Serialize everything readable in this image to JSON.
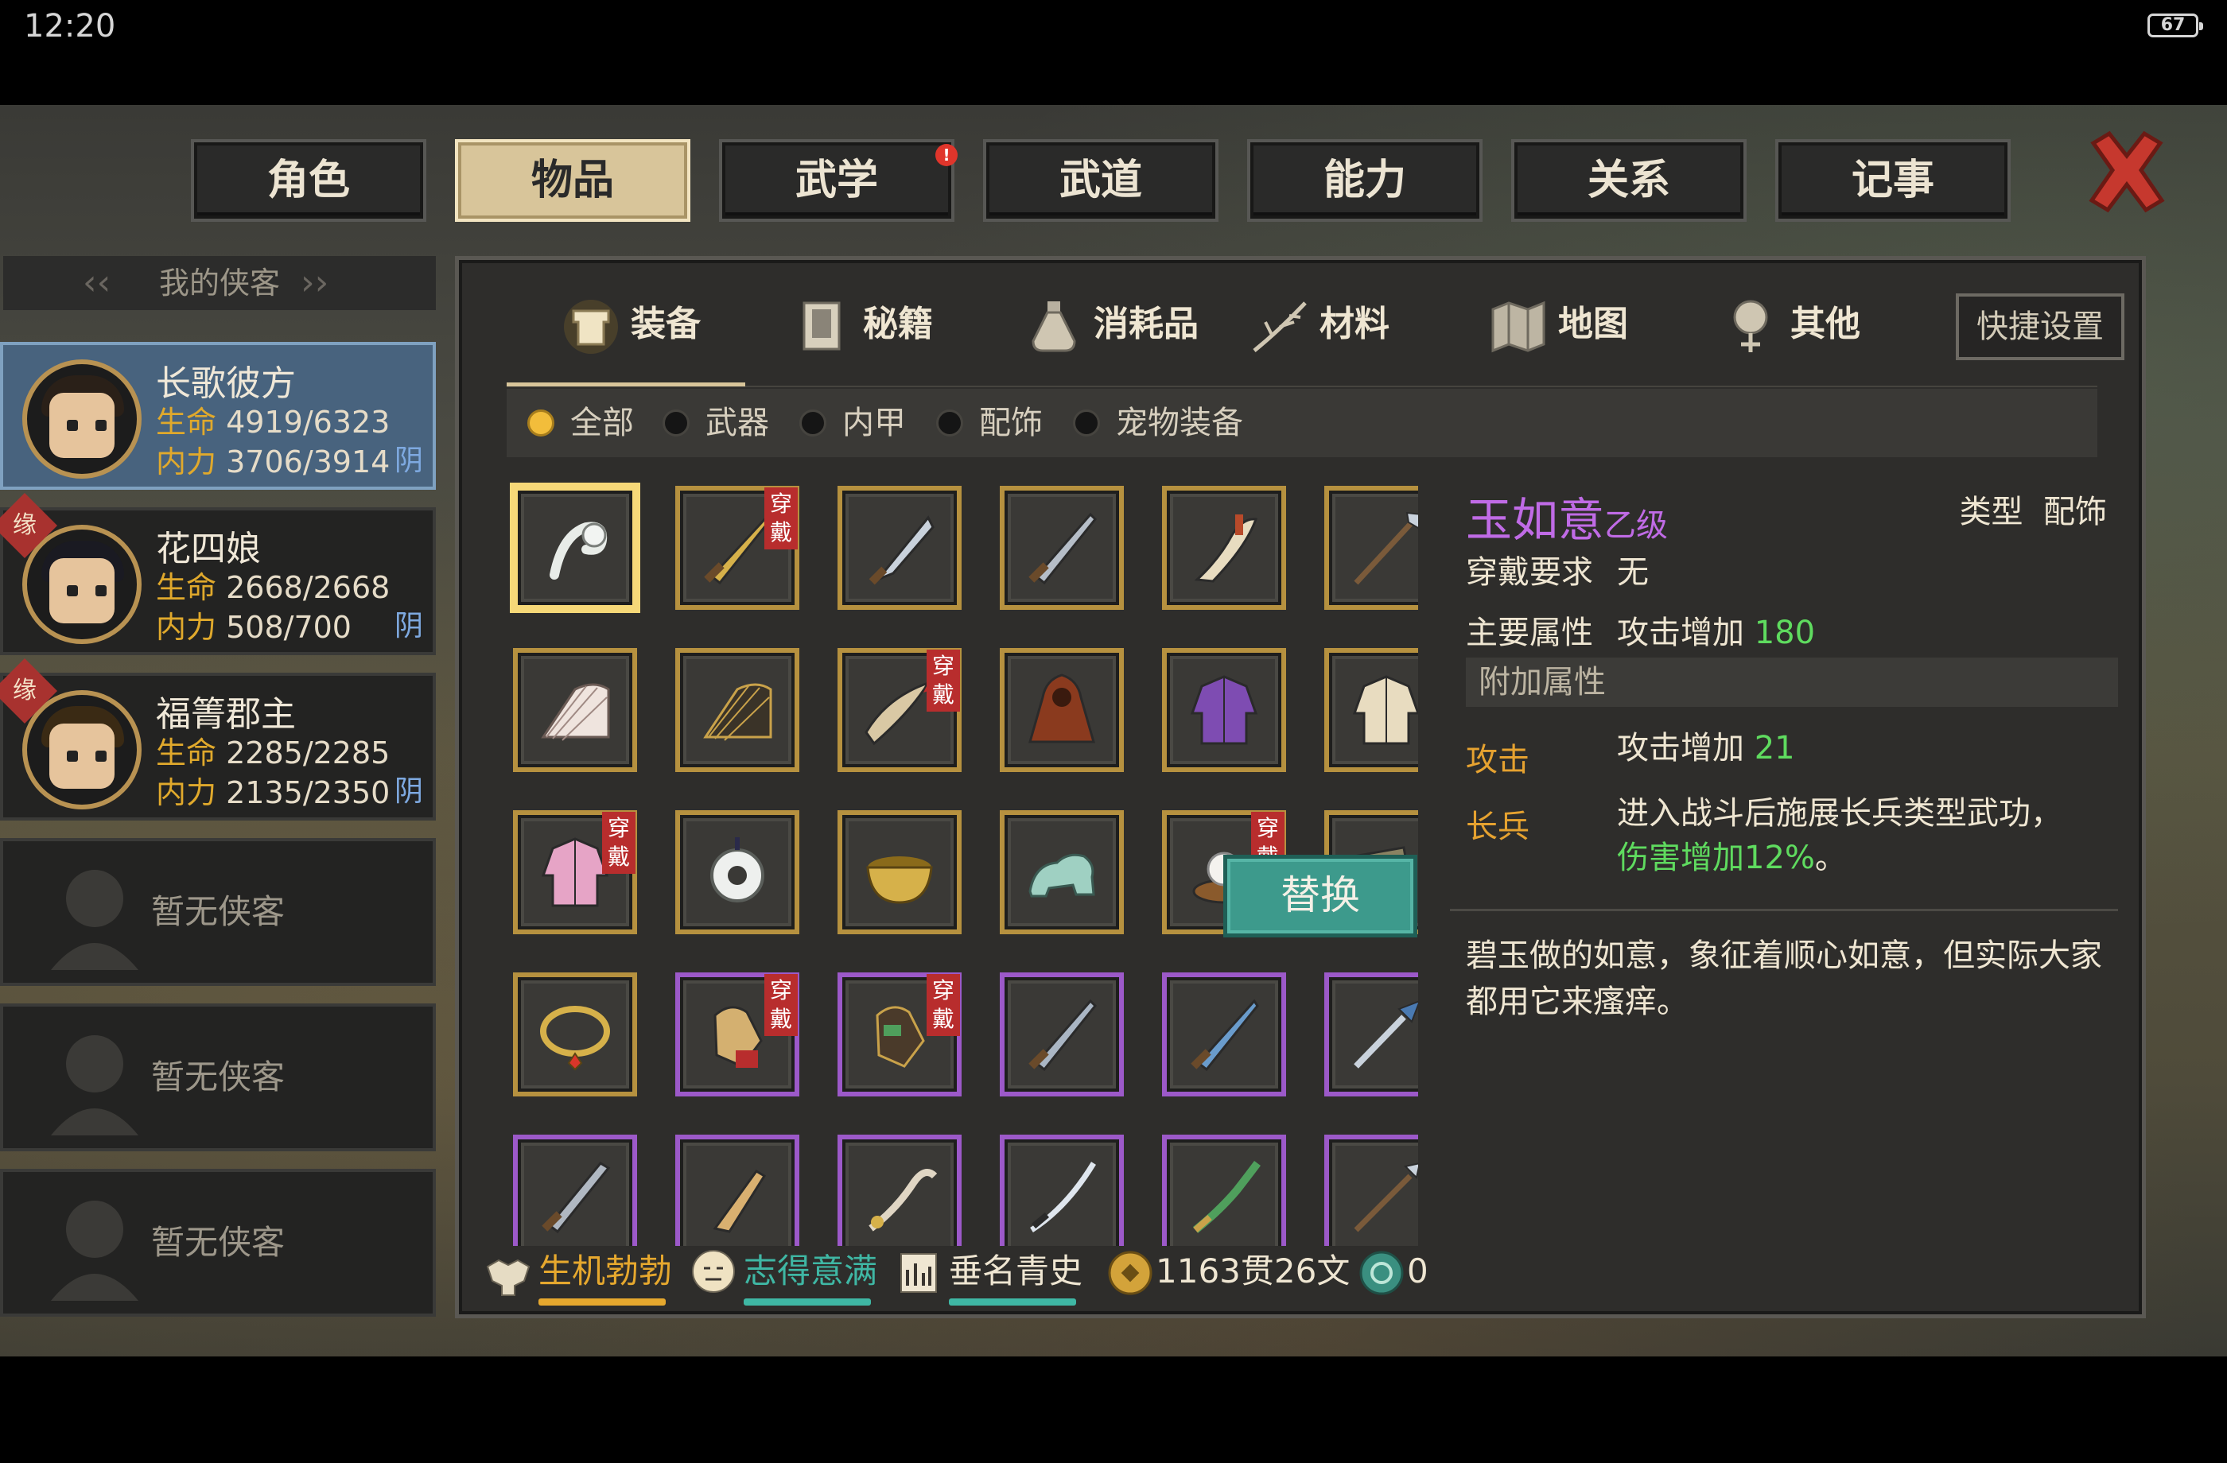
{
  "statusbar": {
    "time": "12:20",
    "battery": "67"
  },
  "tabs": [
    {
      "label": "角色",
      "active": false
    },
    {
      "label": "物品",
      "active": true
    },
    {
      "label": "武学",
      "active": false,
      "badge": "!"
    },
    {
      "label": "武道",
      "active": false
    },
    {
      "label": "能力",
      "active": false
    },
    {
      "label": "关系",
      "active": false
    },
    {
      "label": "记事",
      "active": false
    }
  ],
  "roster": {
    "title": "我的侠客",
    "characters": [
      {
        "name": "长歌彼方",
        "hp_label": "生命",
        "hp": "4919/6323",
        "mp_label": "内力",
        "mp": "3706/3914",
        "yin": "阴",
        "selected": true
      },
      {
        "name": "花四娘",
        "hp_label": "生命",
        "hp": "2668/2668",
        "mp_label": "内力",
        "mp": "508/700",
        "yin": "阴",
        "badge": "缘"
      },
      {
        "name": "福箐郡主",
        "hp_label": "生命",
        "hp": "2285/2285",
        "mp_label": "内力",
        "mp": "2135/2350",
        "yin": "阴",
        "badge": "缘"
      }
    ],
    "empty_label": "暂无侠客"
  },
  "categories": [
    {
      "label": "装备",
      "icon": "armor-icon",
      "active": true
    },
    {
      "label": "秘籍",
      "icon": "book-icon"
    },
    {
      "label": "消耗品",
      "icon": "potion-icon"
    },
    {
      "label": "材料",
      "icon": "herb-icon"
    },
    {
      "label": "地图",
      "icon": "map-icon"
    },
    {
      "label": "其他",
      "icon": "misc-icon"
    }
  ],
  "shortcut_label": "快捷设置",
  "filters": [
    {
      "label": "全部",
      "on": true
    },
    {
      "label": "武器",
      "on": false
    },
    {
      "label": "内甲",
      "on": false
    },
    {
      "label": "配饰",
      "on": false
    },
    {
      "label": "宠物装备",
      "on": false
    }
  ],
  "worn_label": "穿戴",
  "items": [
    {
      "icon": "ruyi-scepter-icon",
      "rarity": "gold",
      "selected": true
    },
    {
      "icon": "golden-spear-icon",
      "rarity": "gold",
      "worn": true
    },
    {
      "icon": "broadsword-icon",
      "rarity": "gold"
    },
    {
      "icon": "long-sword-icon",
      "rarity": "gold"
    },
    {
      "icon": "curved-saber-icon",
      "rarity": "gold"
    },
    {
      "icon": "halberd-icon",
      "rarity": "gold"
    },
    {
      "icon": "white-fan-icon",
      "rarity": "gold"
    },
    {
      "icon": "dark-fan-icon",
      "rarity": "gold"
    },
    {
      "icon": "horn-blade-icon",
      "rarity": "gold",
      "worn": true
    },
    {
      "icon": "brown-cloak-icon",
      "rarity": "gold"
    },
    {
      "icon": "purple-armor-icon",
      "rarity": "gold"
    },
    {
      "icon": "white-robe-icon",
      "rarity": "gold"
    },
    {
      "icon": "pink-dress-icon",
      "rarity": "gold",
      "worn": true
    },
    {
      "icon": "jade-pendant-icon",
      "rarity": "gold"
    },
    {
      "icon": "gold-bowl-icon",
      "rarity": "gold"
    },
    {
      "icon": "jade-beast-icon",
      "rarity": "gold"
    },
    {
      "icon": "pearl-stand-icon",
      "rarity": "gold",
      "worn": true
    },
    {
      "icon": "satchel-icon",
      "rarity": "gold"
    },
    {
      "icon": "gold-necklace-icon",
      "rarity": "gold"
    },
    {
      "icon": "gauntlet-icon",
      "rarity": "purple",
      "worn": true
    },
    {
      "icon": "dark-gauntlet-icon",
      "rarity": "purple",
      "worn": true
    },
    {
      "icon": "steel-sword-icon",
      "rarity": "purple"
    },
    {
      "icon": "blue-sword-icon",
      "rarity": "purple"
    },
    {
      "icon": "spear-tip-icon",
      "rarity": "purple"
    },
    {
      "icon": "short-sword-icon",
      "rarity": "purple"
    },
    {
      "icon": "dagger-icon",
      "rarity": "purple"
    },
    {
      "icon": "hook-saber-icon",
      "rarity": "purple"
    },
    {
      "icon": "katana-icon",
      "rarity": "purple"
    },
    {
      "icon": "green-blade-icon",
      "rarity": "purple"
    },
    {
      "icon": "trident-icon",
      "rarity": "purple"
    }
  ],
  "detail": {
    "name": "玉如意",
    "grade": "乙级",
    "type_label": "类型",
    "type_value": "配饰",
    "req_label": "穿戴要求",
    "req_value": "无",
    "main_label": "主要属性",
    "main_value": "攻击增加",
    "main_num": "180",
    "extra_label": "附加属性",
    "attr1_name": "攻击",
    "attr1_value": "攻击增加",
    "attr1_num": "21",
    "attr2_name": "长兵",
    "attr2_value": "进入战斗后施展长兵类型武功，",
    "attr2_effect": "伤害增加12%",
    "attr2_end": "。",
    "description": "碧玉做的如意，象征着顺心如意，但实际大家都用它来瘙痒。"
  },
  "replace_label": "替换",
  "status": [
    {
      "label": "生机勃勃",
      "icon": "strength-icon",
      "color": "#e6a82e"
    },
    {
      "label": "志得意满",
      "icon": "smile-icon",
      "color": "#3fb7a4"
    },
    {
      "label": "垂名青史",
      "icon": "fame-icon",
      "color": "#efe6d2"
    }
  ],
  "currency": {
    "money": "1163贯26文",
    "gems": "0"
  }
}
